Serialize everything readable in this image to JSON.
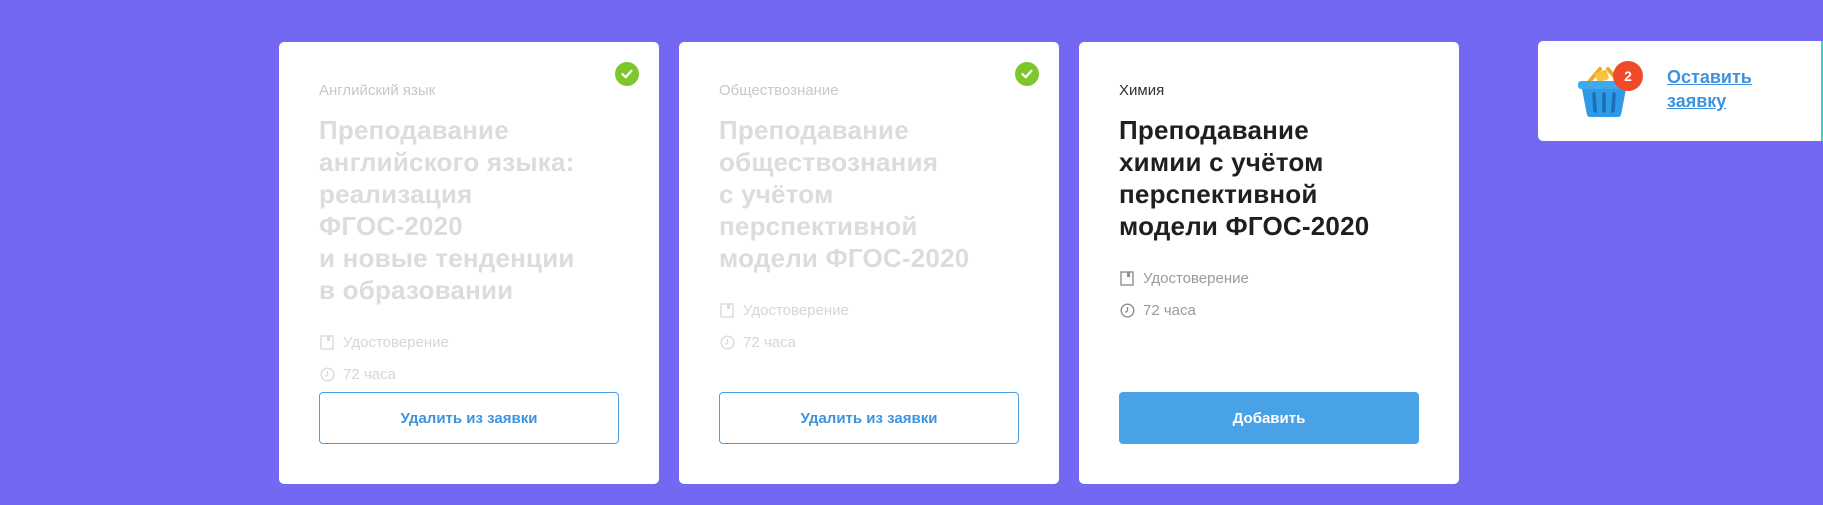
{
  "colors": {
    "background": "#7368f2",
    "accent": "#4aa2e6",
    "check": "#7dc62b",
    "badge": "#f04a2a"
  },
  "cards": [
    {
      "subject": "Английский язык",
      "title": "Преподавание\nанглийского языка:\nреализация ФГОС-2020\nи новые тенденции\nв образовании",
      "document": "Удостоверение",
      "hours": "72 часа",
      "button_label": "Удалить из заявки",
      "selected": true,
      "icons": [
        "check-icon",
        "document-icon",
        "clock-icon"
      ]
    },
    {
      "subject": "Обществознание",
      "title": "Преподавание\nобществознания\nс учётом перспективной\nмодели ФГОС-2020",
      "document": "Удостоверение",
      "hours": "72 часа",
      "button_label": "Удалить из заявки",
      "selected": true,
      "icons": [
        "check-icon",
        "document-icon",
        "clock-icon"
      ]
    },
    {
      "subject": "Химия",
      "title": "Преподавание\nхимии с учётом\nперспективной\nмодели ФГОС-2020",
      "document": "Удостоверение",
      "hours": "72 часа",
      "button_label": "Добавить",
      "selected": false,
      "icons": [
        "document-icon",
        "clock-icon"
      ]
    }
  ],
  "basket": {
    "count": "2",
    "link_label": "Оставить\nзаявку",
    "icon": "basket-icon"
  }
}
